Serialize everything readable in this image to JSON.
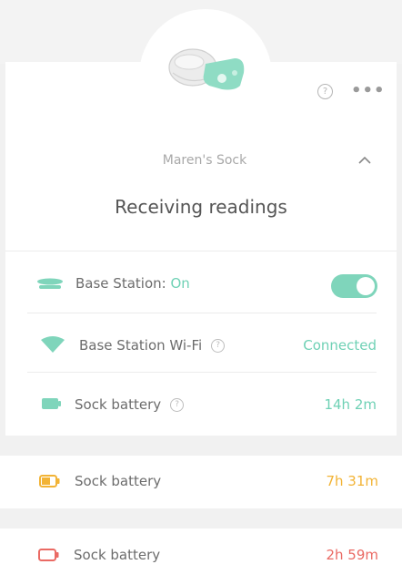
{
  "header": {
    "help_icon": "question-circle",
    "more_icon": "ellipsis-horizontal",
    "help_glyph": "?",
    "more_glyph": "•••"
  },
  "sock": {
    "name": "Maren's Sock",
    "status": "Receiving readings"
  },
  "rows": [
    {
      "label": "Base Station: ",
      "label_accent": "On",
      "icon": "base-station-icon",
      "toggle_on": true
    },
    {
      "label": "Base Station Wi-Fi",
      "value": "Connected",
      "icon": "wifi-icon",
      "has_help": true
    },
    {
      "label": "Sock battery",
      "value": "14h 2m",
      "icon": "battery-full-icon",
      "has_help": true
    }
  ],
  "battery_cards": [
    {
      "label": "Sock battery",
      "value": "7h 31m",
      "icon": "battery-half-icon"
    },
    {
      "label": "Sock battery",
      "value": "2h 59m",
      "icon": "battery-low-icon"
    }
  ],
  "colors": {
    "accent": "#6fd1b5",
    "toggle": "#7fd5bb",
    "warning": "#f2b335",
    "danger": "#ea6a64",
    "text": "#555555"
  }
}
